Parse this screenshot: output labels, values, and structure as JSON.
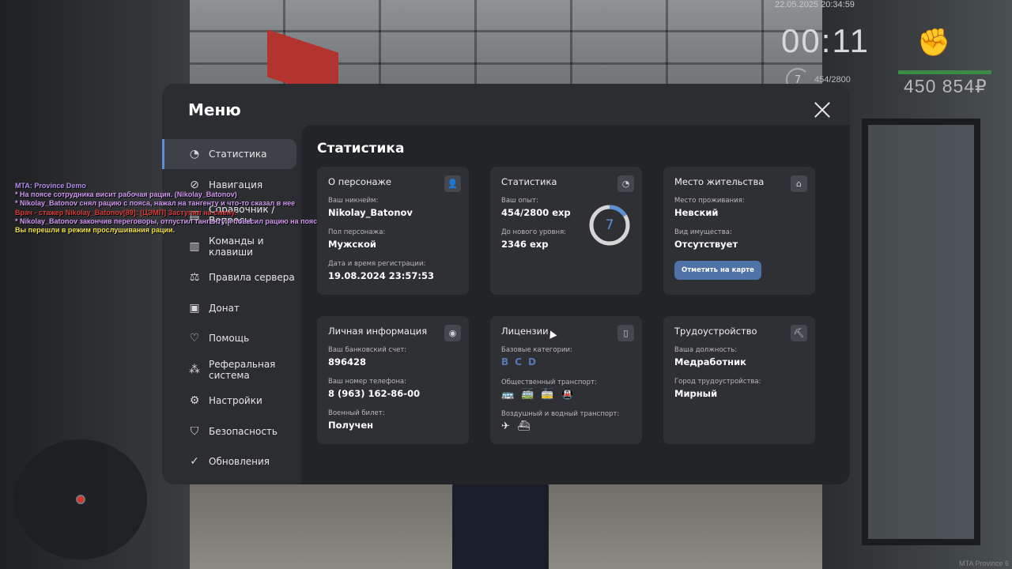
{
  "hud": {
    "datetime": "22.05.2025 20:34:59",
    "clock": "00:11",
    "level": "7",
    "exp": "454/2800",
    "money": "450 854₽",
    "watermark": "MTA Province 6"
  },
  "chat": {
    "title": "MTA: Province Demo",
    "lines": [
      "* На поясе сотрудника висит рабочая рация. (Nikolay_Batonov)",
      "* Nikolay_Batonov снял рацию с пояса, нажал на тангенту и что-то сказал в нее",
      "Врач - стажер Nikolay_Batonov[89]: [ЦЭМП] Заступил на смену.",
      "* Nikolay_Batonov закончив переговоры, отпустил тангенту и повесил рацию на пояс",
      "Вы перешли в режим прослушивания рации."
    ]
  },
  "menu": {
    "title": "Меню",
    "sidebar": [
      {
        "label": "Статистика",
        "icon": "pie-chart-icon"
      },
      {
        "label": "Навигация",
        "icon": "compass-icon"
      },
      {
        "label": "Справочник / Вопросы",
        "icon": "book-icon"
      },
      {
        "label": "Команды и клавиши",
        "icon": "document-icon"
      },
      {
        "label": "Правила сервера",
        "icon": "scales-icon"
      },
      {
        "label": "Донат",
        "icon": "wallet-icon"
      },
      {
        "label": "Помощь",
        "icon": "handshake-icon"
      },
      {
        "label": "Реферальная система",
        "icon": "network-icon"
      },
      {
        "label": "Настройки",
        "icon": "gear-icon"
      },
      {
        "label": "Безопасность",
        "icon": "shield-icon"
      },
      {
        "label": "Обновления",
        "icon": "check-circle-icon"
      }
    ]
  },
  "stats": {
    "title": "Статистика",
    "character": {
      "title": "О персонаже",
      "nick_label": "Ваш никнейм:",
      "nick": "Nikolay_Batonov",
      "sex_label": "Пол персонажа:",
      "sex": "Мужской",
      "reg_label": "Дата и время регистрации:",
      "reg": "19.08.2024 23:57:53"
    },
    "statistics": {
      "title": "Статистика",
      "exp_label": "Ваш опыт:",
      "exp": "454/2800 exp",
      "next_label": "До нового уровня:",
      "next": "2346 exp",
      "level": "7",
      "progress": 0.162
    },
    "residence": {
      "title": "Место жительства",
      "place_label": "Место проживания:",
      "place": "Невский",
      "property_label": "Вид имущества:",
      "property": "Отсутствует",
      "button": "Отметить на карте"
    },
    "personal": {
      "title": "Личная информация",
      "bank_label": "Ваш банковский счет:",
      "bank": "896428",
      "phone_label": "Ваш номер телефона:",
      "phone": "8 (963) 162-86-00",
      "military_label": "Военный билет:",
      "military": "Получен"
    },
    "licenses": {
      "title": "Лицензии",
      "base_label": "Базовые категории:",
      "categories": [
        "B",
        "C",
        "D"
      ],
      "public_label": "Общественный транспорт:",
      "air_label": "Воздушный и водный транспорт:"
    },
    "employment": {
      "title": "Трудоустройство",
      "post_label": "Ваша должность:",
      "post": "Медработник",
      "city_label": "Город трудоустройства:",
      "city": "Мирный"
    }
  },
  "colors": {
    "accent": "#5b8fd6",
    "button": "#4f73a8",
    "panel": "#2c2d30",
    "card": "#2f3034"
  }
}
